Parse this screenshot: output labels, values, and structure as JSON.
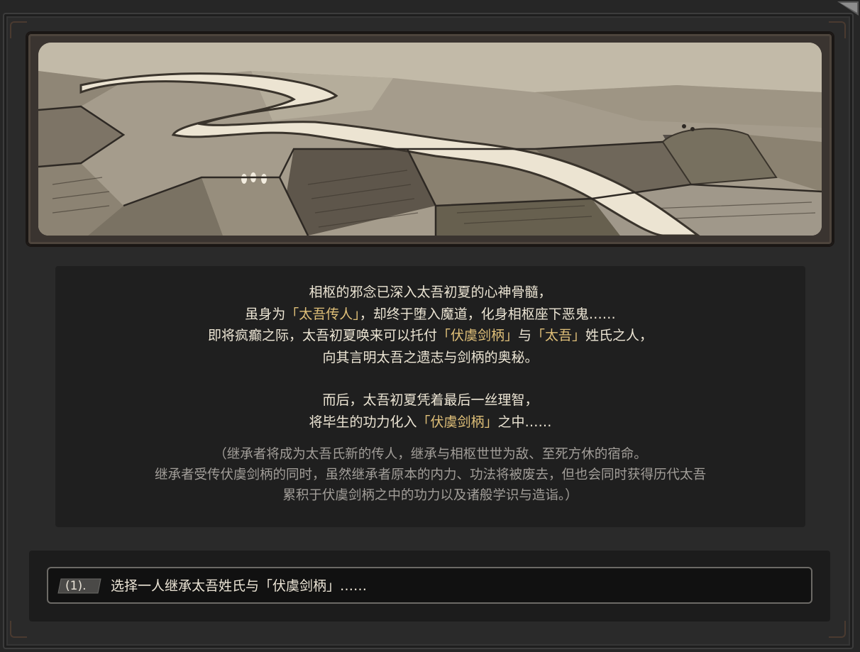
{
  "story": {
    "lines_1": [
      [
        {
          "t": "相枢的邪念已深入太吾初夏的心神骨髓，"
        }
      ],
      [
        {
          "t": "虽身为"
        },
        {
          "t": "「太吾传人」",
          "h": true
        },
        {
          "t": "，却终于堕入魔道，化身相枢座下恶鬼……"
        }
      ],
      [
        {
          "t": "即将疯癫之际，太吾初夏唤来可以托付"
        },
        {
          "t": "「伏虞剑柄」",
          "h": true
        },
        {
          "t": "与"
        },
        {
          "t": "「太吾」",
          "h": true
        },
        {
          "t": "姓氏之人，"
        }
      ],
      [
        {
          "t": "向其言明太吾之遗志与剑柄的奥秘。"
        }
      ]
    ],
    "lines_2": [
      [
        {
          "t": "而后，太吾初夏凭着最后一丝理智，"
        }
      ],
      [
        {
          "t": "将毕生的功力化入"
        },
        {
          "t": "「伏虞剑柄」",
          "h": true
        },
        {
          "t": "之中……"
        }
      ]
    ],
    "note": [
      "（继承者将成为太吾氏新的传人，继承与相枢世世为敌、至死方休的宿命。",
      "继承者受传伏虞剑柄的同时，虽然继承者原本的内力、功法将被废去，但也会同时获得历代太吾",
      "累积于伏虞剑柄之中的功力以及诸般学识与造诣。）"
    ]
  },
  "option": {
    "number": "(1).",
    "label": "选择一人继承太吾姓氏与「伏虞剑柄」……"
  },
  "colors": {
    "highlight": "#e0c079",
    "text": "#ece5d4",
    "note": "#a29e99"
  }
}
